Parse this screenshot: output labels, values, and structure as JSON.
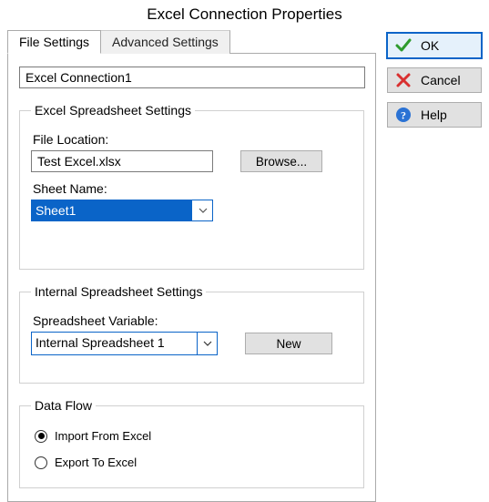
{
  "window": {
    "title": "Excel Connection Properties"
  },
  "tabs": {
    "file_settings": "File Settings",
    "advanced_settings": "Advanced Settings"
  },
  "connection_name": "Excel Connection1",
  "excel_group": {
    "legend": "Excel Spreadsheet Settings",
    "file_location_label": "File Location:",
    "file_location_value": "Test Excel.xlsx",
    "browse_label": "Browse...",
    "sheet_name_label": "Sheet Name:",
    "sheet_name_value": "Sheet1"
  },
  "internal_group": {
    "legend": "Internal Spreadsheet Settings",
    "variable_label": "Spreadsheet Variable:",
    "variable_value": "Internal Spreadsheet 1",
    "new_label": "New"
  },
  "dataflow_group": {
    "legend": "Data Flow",
    "import_label": "Import From Excel",
    "export_label": "Export To Excel"
  },
  "buttons": {
    "ok": "OK",
    "cancel": "Cancel",
    "help": "Help"
  }
}
